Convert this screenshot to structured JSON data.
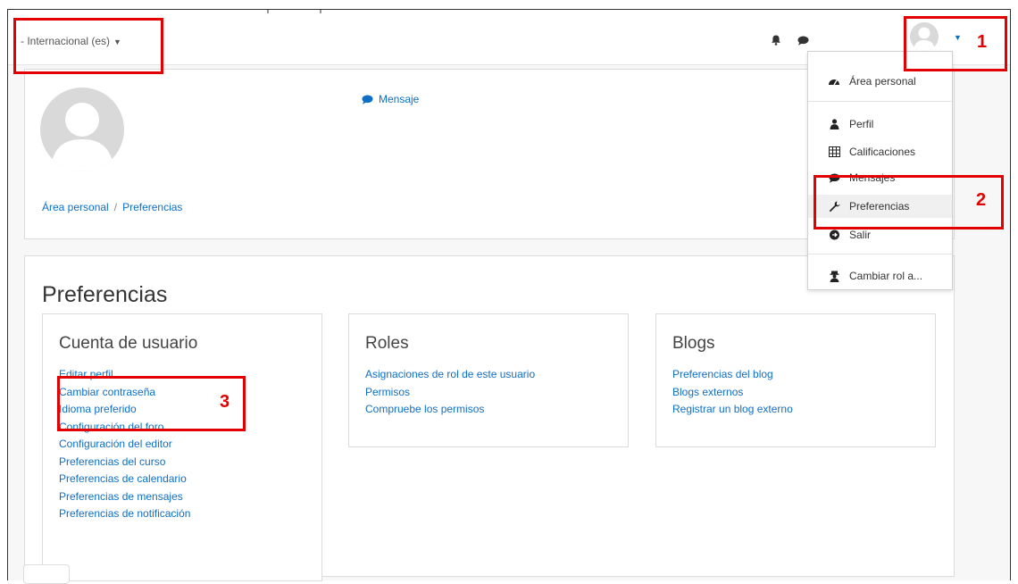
{
  "header": {
    "language": "- Internacional (es)",
    "icons": {
      "notifications": "bell-icon",
      "messages": "chat-icon",
      "avatar": "user-avatar-icon"
    }
  },
  "profile": {
    "message_link": "Mensaje",
    "breadcrumb": [
      "Área personal",
      "Preferencias"
    ]
  },
  "main": {
    "title": "Preferencias",
    "sections": [
      {
        "title": "Cuenta de usuario",
        "links": [
          "Editar perfil",
          "Cambiar contraseña",
          "Idioma preferido",
          "Configuración del foro",
          "Configuración del editor",
          "Preferencias del curso",
          "Preferencias de calendario",
          "Preferencias de mensajes",
          "Preferencias de notificación"
        ]
      },
      {
        "title": "Roles",
        "links": [
          "Asignaciones de rol de este usuario",
          "Permisos",
          "Compruebe los permisos"
        ]
      },
      {
        "title": "Blogs",
        "links": [
          "Preferencias del blog",
          "Blogs externos",
          "Registrar un blog externo"
        ]
      }
    ]
  },
  "user_menu": {
    "items": [
      {
        "label": "Área personal",
        "icon": "dashboard-icon"
      },
      {
        "label": "Perfil",
        "icon": "user-icon"
      },
      {
        "label": "Calificaciones",
        "icon": "grid-icon"
      },
      {
        "label": "Mensajes",
        "icon": "chat-icon"
      },
      {
        "label": "Preferencias",
        "icon": "wrench-icon"
      },
      {
        "label": "Salir",
        "icon": "sign-out-icon"
      },
      {
        "label": "Cambiar rol a...",
        "icon": "user-secret-icon"
      }
    ]
  },
  "annotations": {
    "numbers": [
      "1",
      "2",
      "3"
    ],
    "color": "#e30000"
  },
  "colors": {
    "link": "#0f6fc5",
    "highlight": "#e30000"
  }
}
